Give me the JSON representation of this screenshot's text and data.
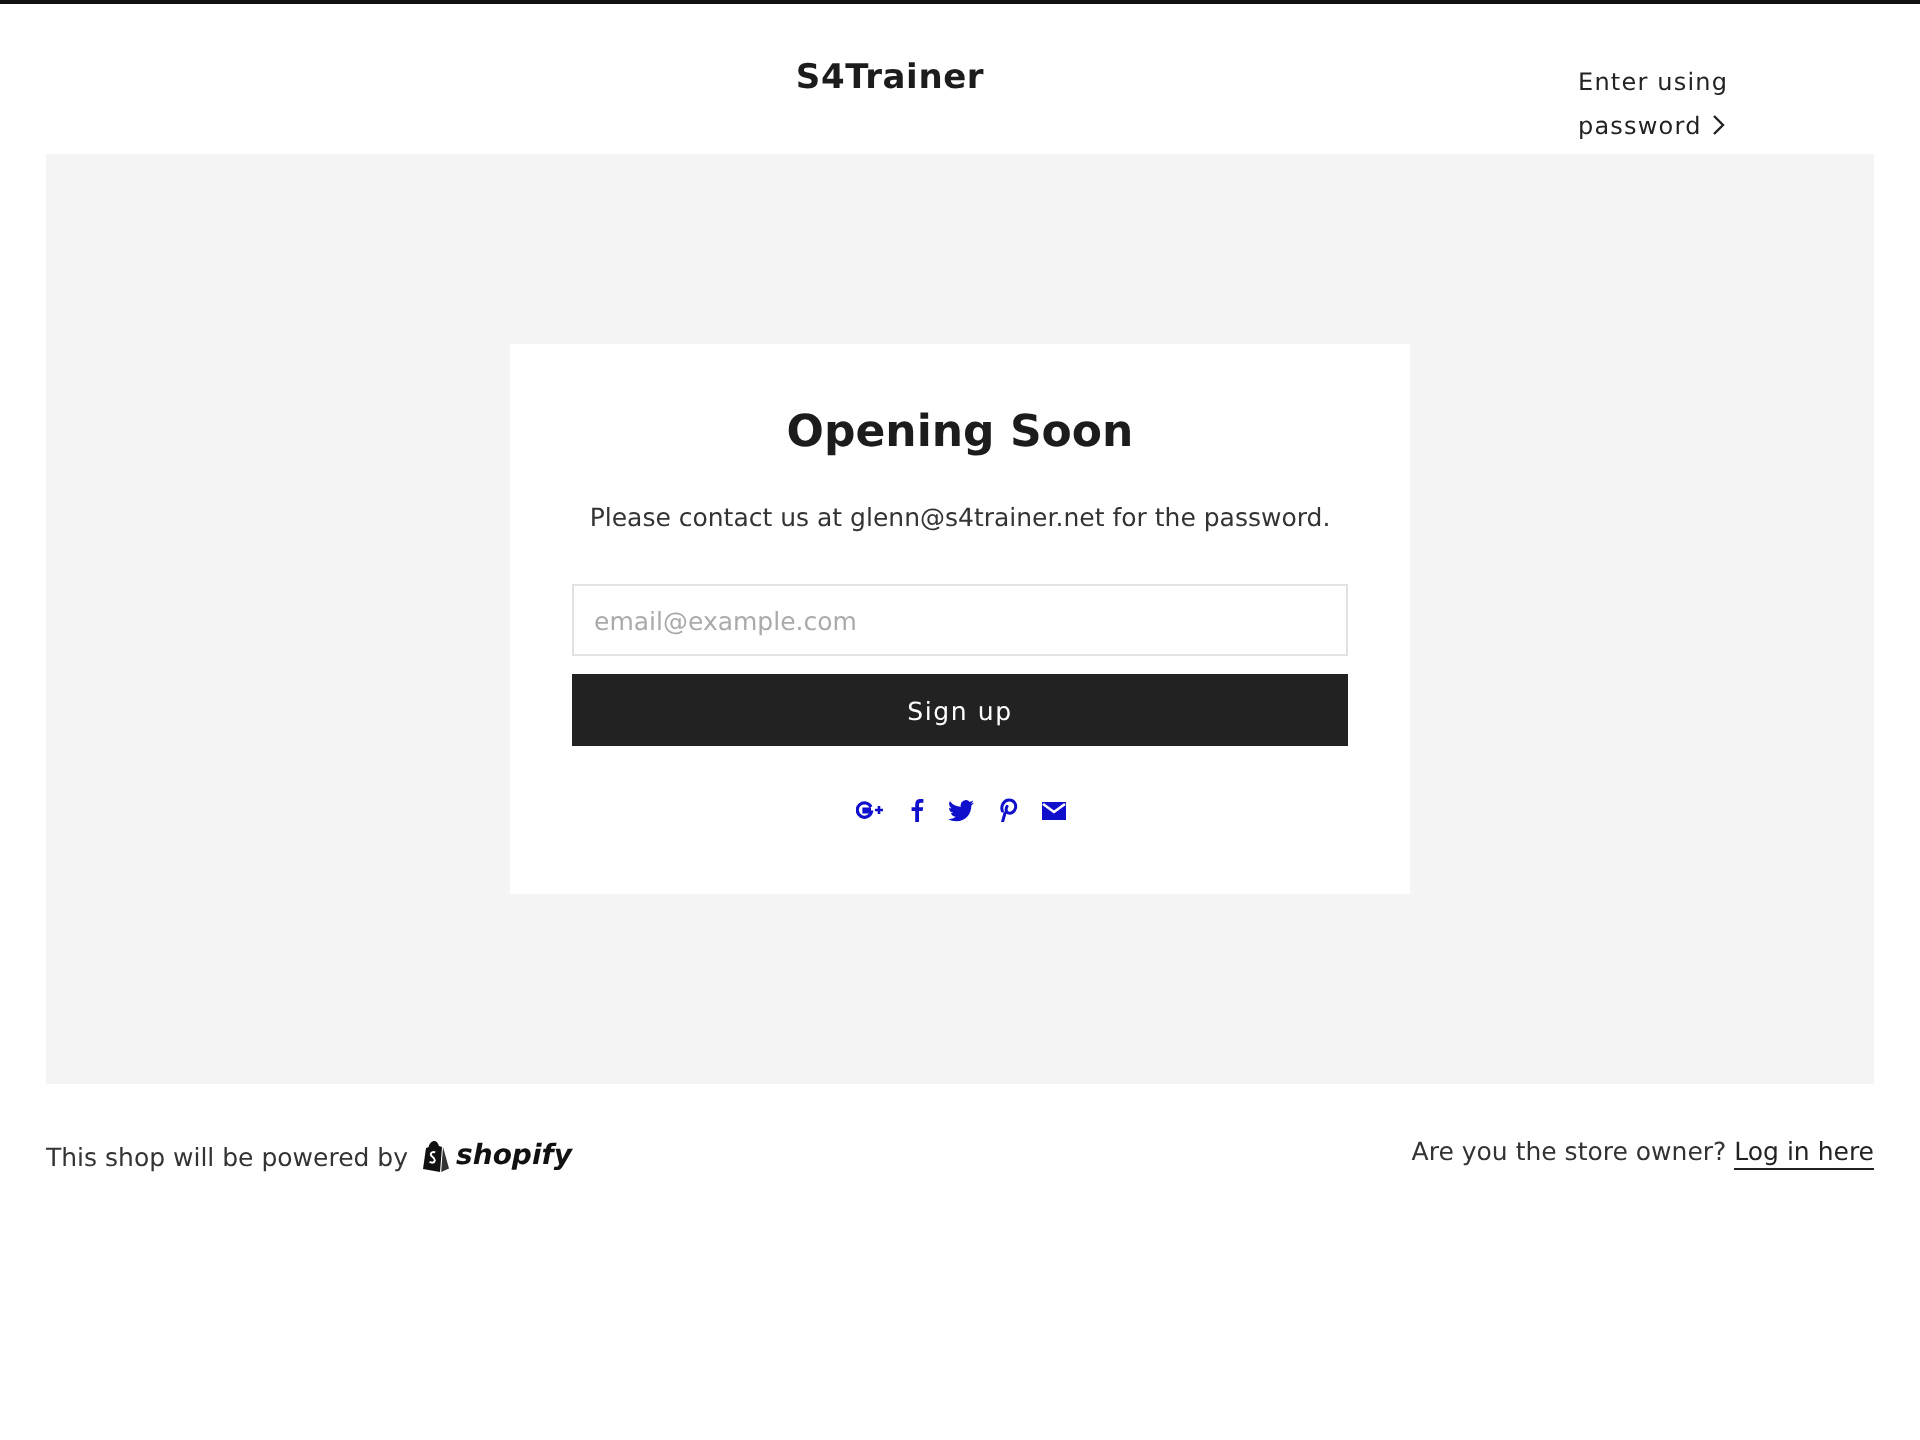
{
  "header": {
    "title": "S4Trainer",
    "enter_link": "Enter using password"
  },
  "card": {
    "heading": "Opening Soon",
    "message": "Please contact us at glenn@s4trainer.net for the password.",
    "email_field": {
      "placeholder": "email@example.com"
    },
    "button": "Sign up"
  },
  "footer": {
    "powered_by": "This shop will be powered by",
    "logo": "shopify",
    "owner_question": "Are you the store owner?",
    "login_link": "Log in here"
  }
}
